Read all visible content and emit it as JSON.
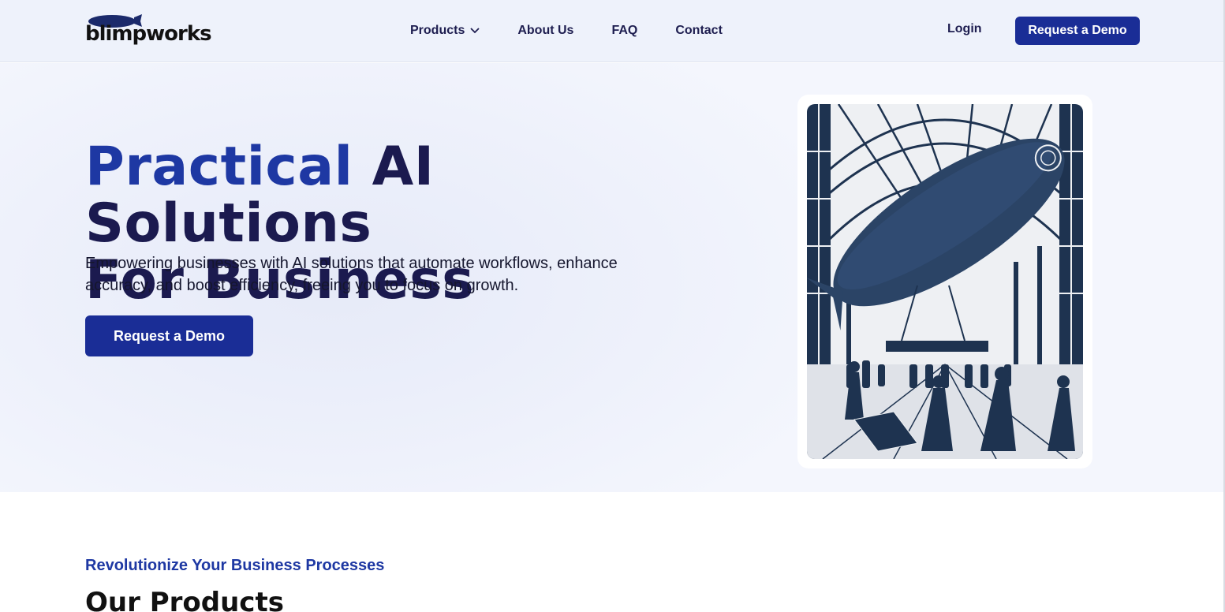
{
  "header": {
    "logo_text": "blimpworks",
    "nav": [
      {
        "label": "Products",
        "has_dropdown": true
      },
      {
        "label": "About Us"
      },
      {
        "label": "FAQ"
      },
      {
        "label": "Contact"
      }
    ],
    "login_label": "Login",
    "cta_label": "Request a Demo"
  },
  "hero": {
    "title_accent": "Practical",
    "title_rest_line1": "AI Solutions",
    "title_line2": "For Business",
    "subtitle": "Empowering businesses with AI solutions that automate workflows, enhance accuracy, and boost efficiency, freeing you to focus on growth.",
    "cta_label": "Request a Demo"
  },
  "products": {
    "kicker": "Revolutionize Your Business Processes",
    "title": "Our Products"
  },
  "colors": {
    "brand_blue": "#1a2d96",
    "accent_text": "#1e38a3",
    "heading": "#1b1a4f"
  }
}
